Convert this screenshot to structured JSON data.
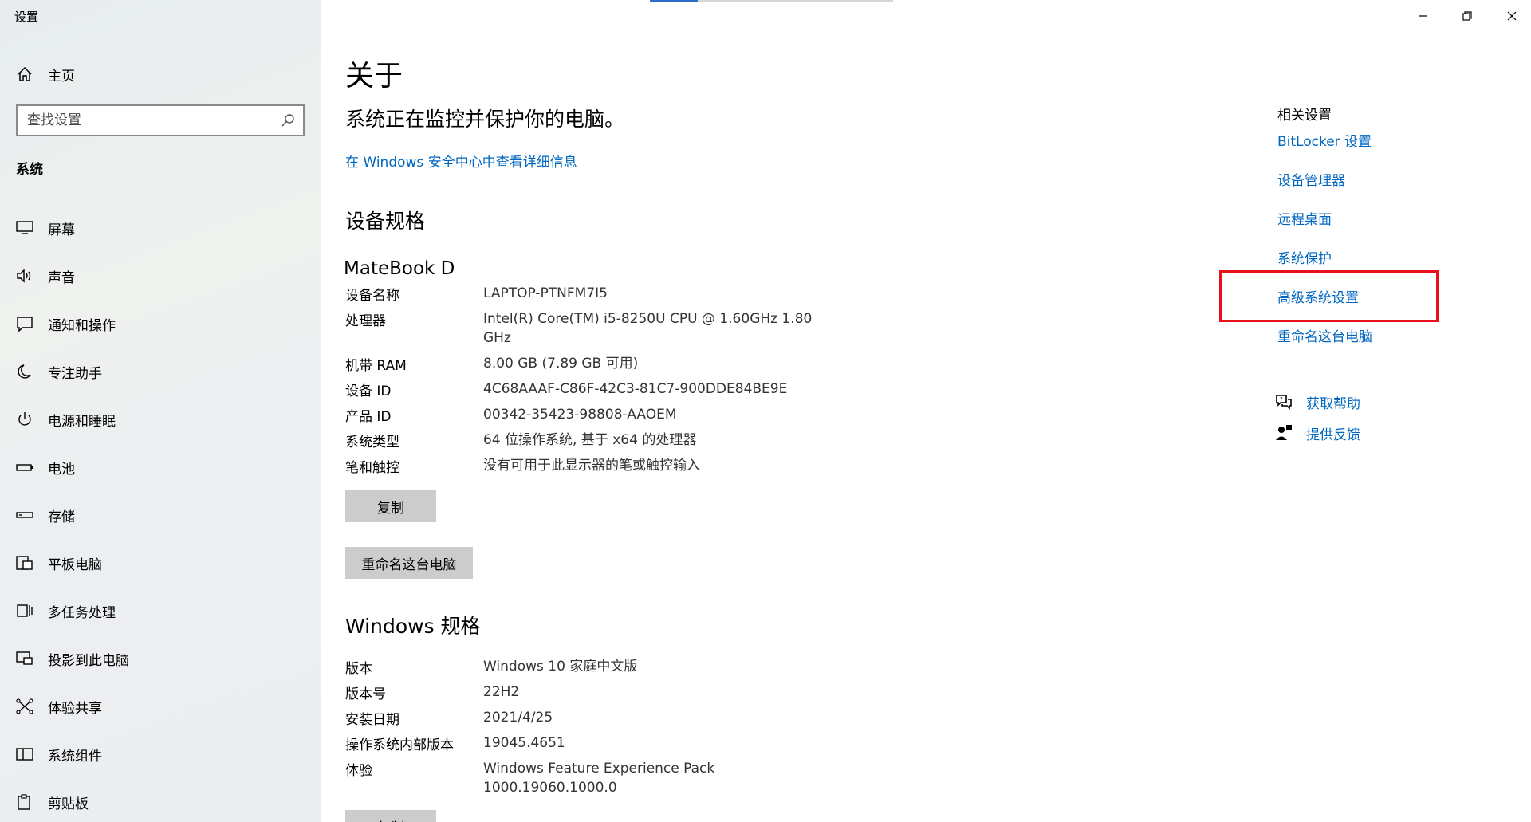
{
  "window": {
    "title": "设置",
    "controls": {
      "minimize_icon": "minimize-icon",
      "restore_icon": "restore-icon",
      "close_icon": "close-icon"
    }
  },
  "sidebar": {
    "home_label": "主页",
    "search_placeholder": "查找设置",
    "section_title": "系统",
    "items": [
      {
        "label": "屏幕",
        "icon": "monitor-icon"
      },
      {
        "label": "声音",
        "icon": "speaker-icon"
      },
      {
        "label": "通知和操作",
        "icon": "notification-icon"
      },
      {
        "label": "专注助手",
        "icon": "moon-icon"
      },
      {
        "label": "电源和睡眠",
        "icon": "power-icon"
      },
      {
        "label": "电池",
        "icon": "battery-icon"
      },
      {
        "label": "存储",
        "icon": "storage-icon"
      },
      {
        "label": "平板电脑",
        "icon": "tablet-icon"
      },
      {
        "label": "多任务处理",
        "icon": "multitask-icon"
      },
      {
        "label": "投影到此电脑",
        "icon": "project-icon"
      },
      {
        "label": "体验共享",
        "icon": "share-icon"
      },
      {
        "label": "系统组件",
        "icon": "components-icon"
      },
      {
        "label": "剪贴板",
        "icon": "clipboard-icon"
      }
    ]
  },
  "main": {
    "title": "关于",
    "protect_text": "系统正在监控并保护你的电脑。",
    "security_link": "在 Windows 安全中心中查看详细信息",
    "device_spec_title": "设备规格",
    "device_model": "MateBook D",
    "device_specs": [
      {
        "key": "设备名称",
        "value": "LAPTOP-PTNFM7I5"
      },
      {
        "key": "处理器",
        "value": "Intel(R) Core(TM) i5-8250U CPU @ 1.60GHz   1.80 GHz"
      },
      {
        "key": "机带 RAM",
        "value": "8.00 GB (7.89 GB 可用)"
      },
      {
        "key": "设备 ID",
        "value": "4C68AAAF-C86F-42C3-81C7-900DDE84BE9E"
      },
      {
        "key": "产品 ID",
        "value": "00342-35423-98808-AAOEM"
      },
      {
        "key": "系统类型",
        "value": "64 位操作系统, 基于 x64 的处理器"
      },
      {
        "key": "笔和触控",
        "value": "没有可用于此显示器的笔或触控输入"
      }
    ],
    "copy_button": "复制",
    "rename_button": "重命名这台电脑",
    "windows_spec_title": "Windows 规格",
    "windows_specs": [
      {
        "key": "版本",
        "value": "Windows 10 家庭中文版"
      },
      {
        "key": "版本号",
        "value": "22H2"
      },
      {
        "key": "安装日期",
        "value": "2021/4/25"
      },
      {
        "key": "操作系统内部版本",
        "value": "19045.4651"
      },
      {
        "key": "体验",
        "value": "Windows Feature Experience Pack 1000.19060.1000.0"
      }
    ],
    "copy_button_2": "复制"
  },
  "related": {
    "title": "相关设置",
    "links": [
      "BitLocker 设置",
      "设备管理器",
      "远程桌面",
      "系统保护",
      "高级系统设置",
      "重命名这台电脑"
    ],
    "help_label": "获取帮助",
    "feedback_label": "提供反馈",
    "highlighted": "高级系统设置"
  },
  "colors": {
    "link": "#0067c0",
    "highlight_border": "#e8101c",
    "button_bg": "#cccccc"
  }
}
